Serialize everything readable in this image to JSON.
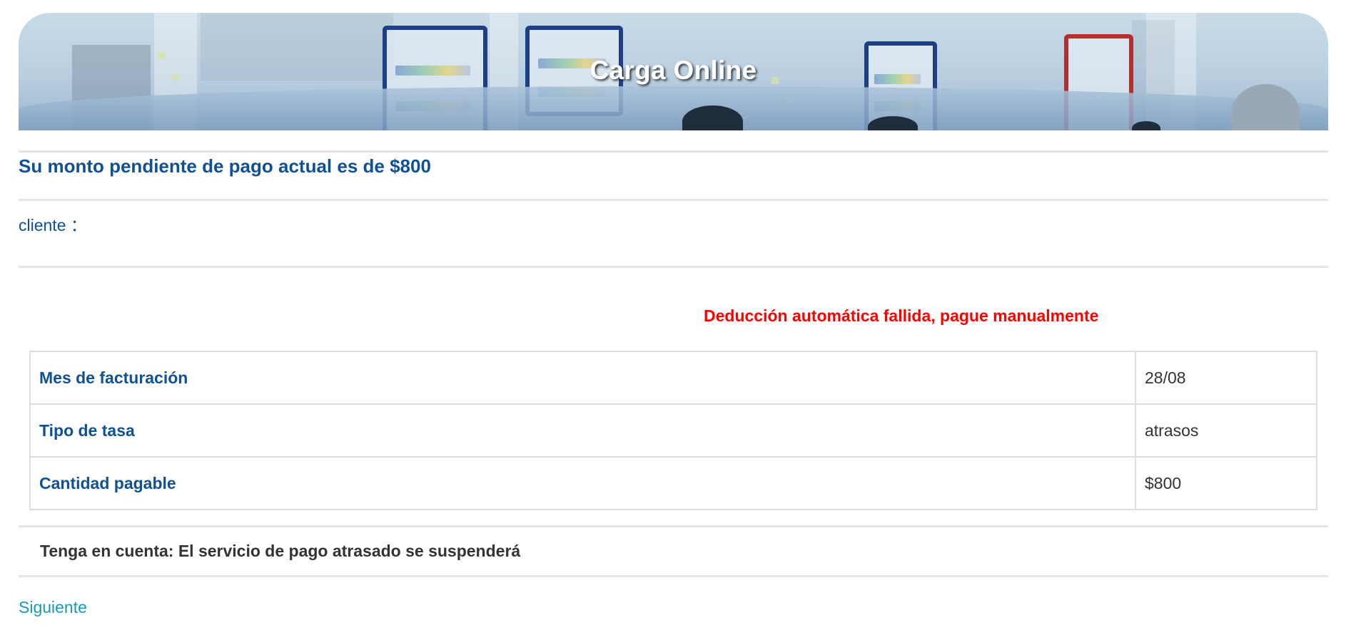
{
  "banner": {
    "title": "Carga Online"
  },
  "summary": {
    "heading": "Su monto pendiente de pago actual es de $800"
  },
  "customer": {
    "label": "cliente ："
  },
  "alert": {
    "message": "Deducción automática fallida, pague manualmente",
    "color": "#ff0000"
  },
  "billing_table": {
    "rows": [
      {
        "label": "Mes de facturación",
        "value": "28/08"
      },
      {
        "label": "Tipo de tasa",
        "value": "atrasos"
      },
      {
        "label": "Cantidad pagable",
        "value": "$800"
      }
    ]
  },
  "notice": {
    "text": "Tenga en cuenta: El servicio de pago atrasado se suspenderá"
  },
  "actions": {
    "next_label": "Siguiente"
  },
  "colors": {
    "primary": "#0f5192",
    "link": "#1899b5",
    "border": "#dddddd"
  }
}
